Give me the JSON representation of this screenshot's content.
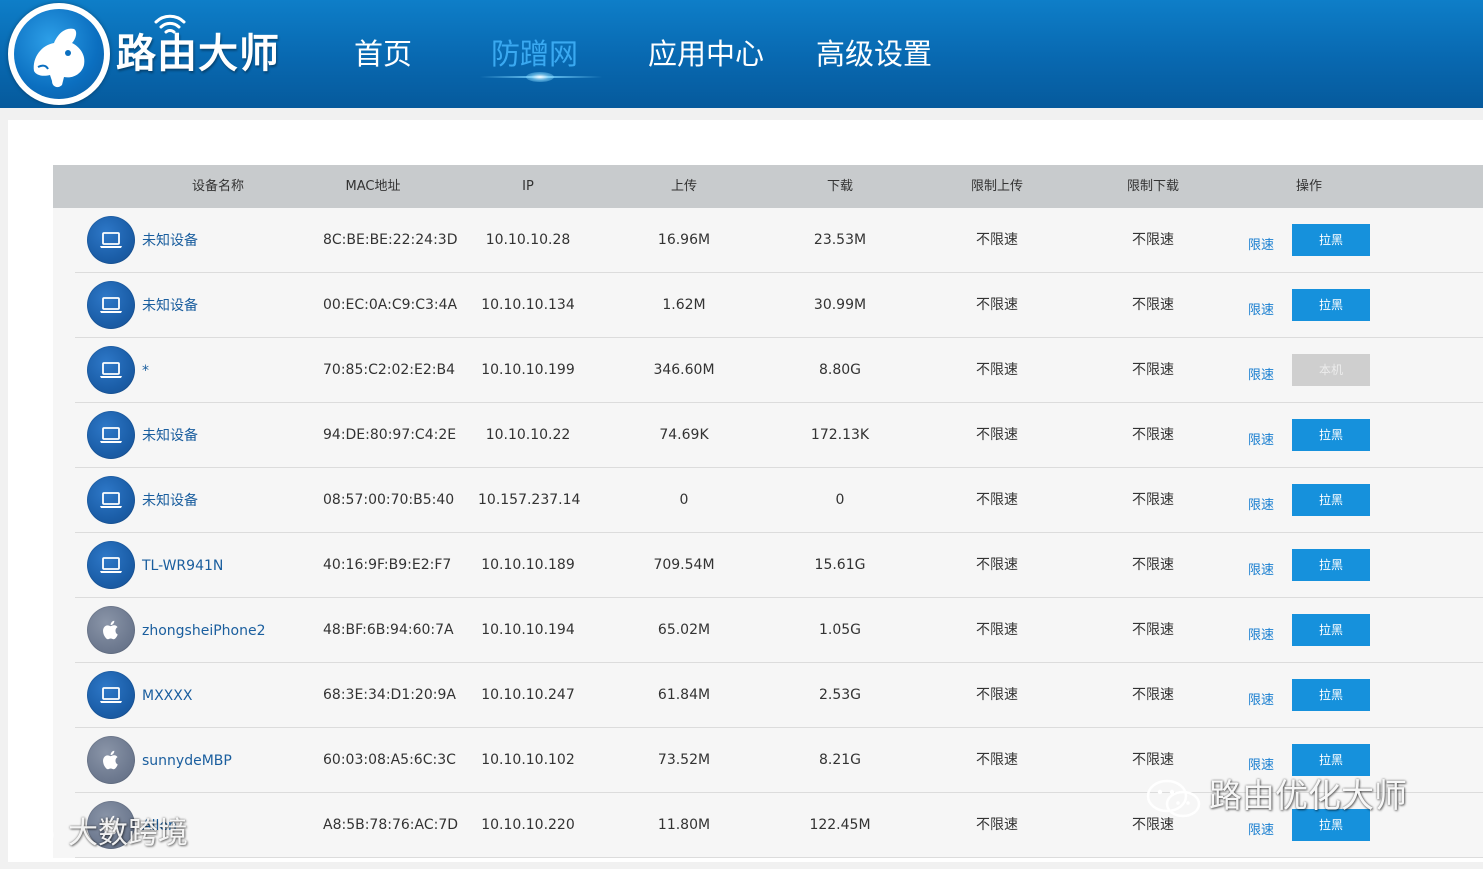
{
  "app": {
    "brand": "路由大师"
  },
  "nav": [
    {
      "label": "首页",
      "active": false
    },
    {
      "label": "防蹭网",
      "active": true
    },
    {
      "label": "应用中心",
      "active": false
    },
    {
      "label": "高级设置",
      "active": false
    }
  ],
  "table": {
    "headers": [
      "设备名称",
      "MAC地址",
      "IP",
      "上传",
      "下载",
      "限制上传",
      "限制下载",
      "操作"
    ],
    "rows": [
      {
        "icon": "laptop-icon",
        "name": "未知设备",
        "mac": "8C:BE:BE:22:24:3D",
        "ip": "10.10.10.28",
        "upload": "16.96M",
        "download": "23.53M",
        "limit_up": "不限速",
        "limit_down": "不限速",
        "limit_link": "限速",
        "action": "拉黑",
        "action_disabled": false
      },
      {
        "icon": "laptop-icon",
        "name": "未知设备",
        "mac": "00:EC:0A:C9:C3:4A",
        "ip": "10.10.10.134",
        "upload": "1.62M",
        "download": "30.99M",
        "limit_up": "不限速",
        "limit_down": "不限速",
        "limit_link": "限速",
        "action": "拉黑",
        "action_disabled": false
      },
      {
        "icon": "laptop-icon",
        "name": "*",
        "mac": "70:85:C2:02:E2:B4",
        "ip": "10.10.10.199",
        "upload": "346.60M",
        "download": "8.80G",
        "limit_up": "不限速",
        "limit_down": "不限速",
        "limit_link": "限速",
        "action": "本机",
        "action_disabled": true
      },
      {
        "icon": "laptop-icon",
        "name": "未知设备",
        "mac": "94:DE:80:97:C4:2E",
        "ip": "10.10.10.22",
        "upload": "74.69K",
        "download": "172.13K",
        "limit_up": "不限速",
        "limit_down": "不限速",
        "limit_link": "限速",
        "action": "拉黑",
        "action_disabled": false
      },
      {
        "icon": "laptop-icon",
        "name": "未知设备",
        "mac": "08:57:00:70:B5:40",
        "ip": "10.157.237.14",
        "upload": "0",
        "download": "0",
        "limit_up": "不限速",
        "limit_down": "不限速",
        "limit_link": "限速",
        "action": "拉黑",
        "action_disabled": false
      },
      {
        "icon": "laptop-icon",
        "name": "TL-WR941N",
        "mac": "40:16:9F:B9:E2:F7",
        "ip": "10.10.10.189",
        "upload": "709.54M",
        "download": "15.61G",
        "limit_up": "不限速",
        "limit_down": "不限速",
        "limit_link": "限速",
        "action": "拉黑",
        "action_disabled": false
      },
      {
        "icon": "apple-icon",
        "name": "zhongsheiPhone2",
        "mac": "48:BF:6B:94:60:7A",
        "ip": "10.10.10.194",
        "upload": "65.02M",
        "download": "1.05G",
        "limit_up": "不限速",
        "limit_down": "不限速",
        "limit_link": "限速",
        "action": "拉黑",
        "action_disabled": false
      },
      {
        "icon": "laptop-icon",
        "name": "MXXXX",
        "mac": "68:3E:34:D1:20:9A",
        "ip": "10.10.10.247",
        "upload": "61.84M",
        "download": "2.53G",
        "limit_up": "不限速",
        "limit_down": "不限速",
        "limit_link": "限速",
        "action": "拉黑",
        "action_disabled": false
      },
      {
        "icon": "apple-icon",
        "name": "sunnydeMBP",
        "mac": "60:03:08:A5:6C:3C",
        "ip": "10.10.10.102",
        "upload": "73.52M",
        "download": "8.21G",
        "limit_up": "不限速",
        "limit_down": "不限速",
        "limit_link": "限速",
        "action": "拉黑",
        "action_disabled": false
      },
      {
        "icon": "apple-icon",
        "name": "Allen",
        "mac": "A8:5B:78:76:AC:7D",
        "ip": "10.10.10.220",
        "upload": "11.80M",
        "download": "122.45M",
        "limit_up": "不限速",
        "limit_down": "不限速",
        "limit_link": "限速",
        "action": "拉黑",
        "action_disabled": false
      }
    ]
  },
  "watermarks": {
    "left": "大数跨境",
    "right": "路由优化大师"
  },
  "colors": {
    "header": "#0868b0",
    "nav_active": "#3aa9f1",
    "action_button": "#1691dc",
    "action_disabled": "#cfcfcf",
    "device_name": "#1a5e9e"
  }
}
